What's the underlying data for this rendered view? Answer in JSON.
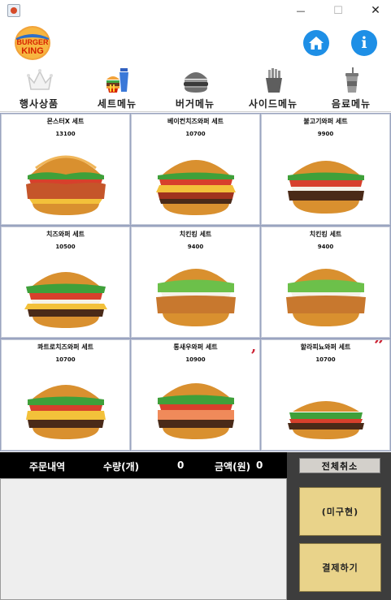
{
  "window": {
    "min_glyph": "—",
    "max_glyph": "☐",
    "close_glyph": "✕"
  },
  "brand": {
    "logo_line1": "BURGER",
    "logo_line2": "KING",
    "colors": {
      "bun": "#f2a33a",
      "text": "#d62300"
    }
  },
  "header": {
    "home_icon": "home-icon",
    "info_icon": "info-icon",
    "info_glyph": "i",
    "button_color": "#1e8fe6"
  },
  "categories": [
    {
      "label": "행사상품",
      "icon": "crown-icon"
    },
    {
      "label": "세트메뉴",
      "icon": "set-meal-icon"
    },
    {
      "label": "버거메뉴",
      "icon": "burger-icon"
    },
    {
      "label": "사이드메뉴",
      "icon": "fries-icon"
    },
    {
      "label": "음료메뉴",
      "icon": "drink-icon"
    }
  ],
  "menu": [
    {
      "name": "몬스터X 세트",
      "price": "13100"
    },
    {
      "name": "베이컨치즈와퍼 세트",
      "price": "10700"
    },
    {
      "name": "불고기와퍼 세트",
      "price": "9900"
    },
    {
      "name": "치즈와퍼 세트",
      "price": "10500"
    },
    {
      "name": "치킨킹 세트",
      "price": "9400"
    },
    {
      "name": "치킨킹 세트",
      "price": "9400"
    },
    {
      "name": "콰트로치즈와퍼 세트",
      "price": "10700"
    },
    {
      "name": "통새우와퍼 세트",
      "price": "10900"
    },
    {
      "name": "할라피뇨와퍼 세트",
      "price": "10700"
    }
  ],
  "order": {
    "title": "주문내역",
    "qty_label": "수량(개)",
    "qty_value": "0",
    "amount_label": "금액(원)",
    "amount_value": "0"
  },
  "actions": {
    "cancel_all": "전체취소",
    "takeout": "(미구현)",
    "pay": "결제하기"
  }
}
